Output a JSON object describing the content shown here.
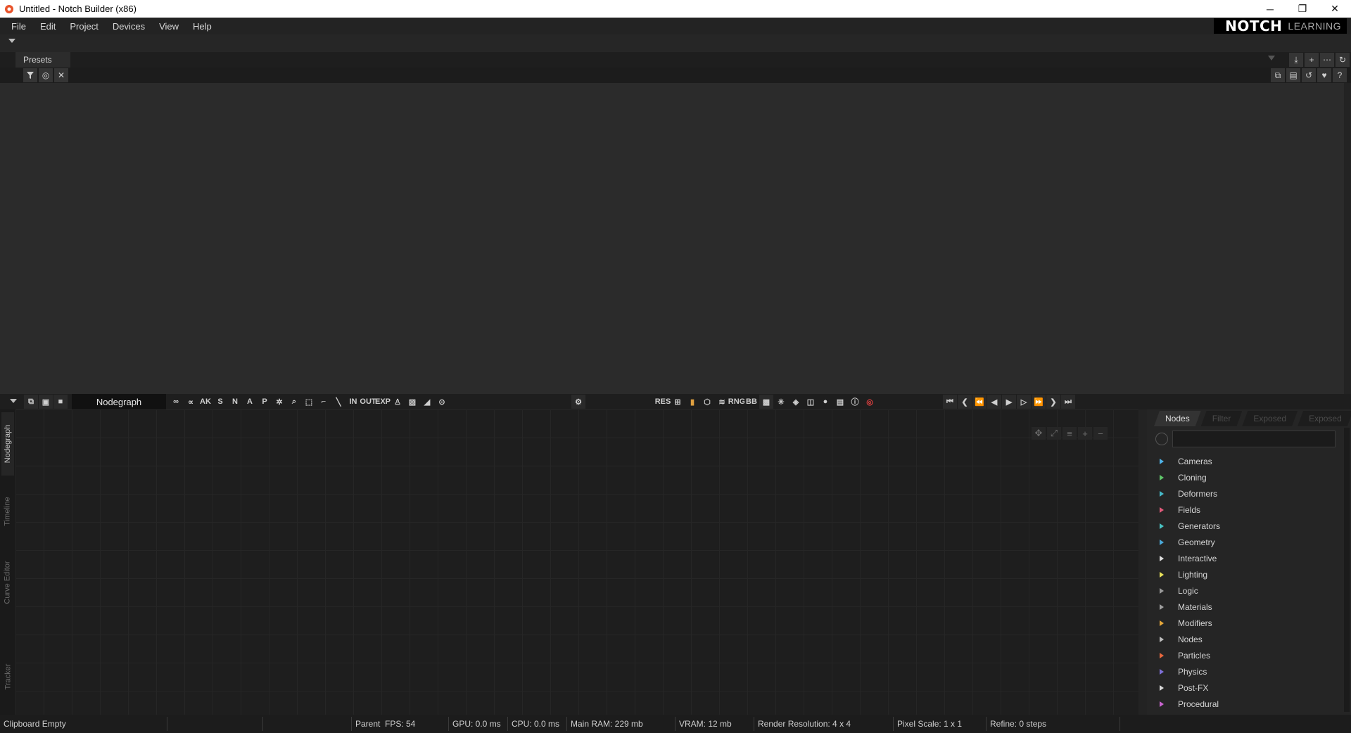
{
  "window": {
    "title": "Untitled - Notch Builder (x86)",
    "controls": {
      "minimize": "─",
      "maximize": "❐",
      "close": "✕"
    }
  },
  "menu": {
    "items": [
      "File",
      "Edit",
      "Project",
      "Devices",
      "View",
      "Help"
    ]
  },
  "brand": {
    "name": "NOTCH",
    "suffix": "LEARNING"
  },
  "presets": {
    "tab_label": "Presets",
    "right_tools": [
      "download-icon",
      "plus-icon",
      "more-icon",
      "refresh-icon"
    ],
    "filter_tools": [
      "filter-icon",
      "target-icon",
      "clear-icon"
    ],
    "side_tools": [
      "copy-icon",
      "paste-icon",
      "undo-icon",
      "favorite-icon",
      "help-icon"
    ]
  },
  "nodegraph": {
    "label": "Nodegraph",
    "toolbar_letters": {
      "ak": "AK",
      "s": "S",
      "n": "N",
      "a": "A",
      "p": "P",
      "in": "IN",
      "out": "OUT",
      "exp": "EXP",
      "rng": "RNG",
      "bb": "BB",
      "res": "RES"
    },
    "side_tabs": [
      "Nodegraph",
      "Timeline",
      "Curve Editor",
      "Tracker"
    ]
  },
  "nodes_panel": {
    "tabs": [
      "Nodes",
      "Filter",
      "Exposed",
      "Exposed"
    ],
    "search_value": "",
    "categories": [
      {
        "label": "Cameras",
        "color": "#4fb3e8"
      },
      {
        "label": "Cloning",
        "color": "#5fc66a"
      },
      {
        "label": "Deformers",
        "color": "#46b9c8"
      },
      {
        "label": "Fields",
        "color": "#e05a7a"
      },
      {
        "label": "Generators",
        "color": "#49c2c2"
      },
      {
        "label": "Geometry",
        "color": "#4aa8d8"
      },
      {
        "label": "Interactive",
        "color": "#dddddd"
      },
      {
        "label": "Lighting",
        "color": "#e7e05a"
      },
      {
        "label": "Logic",
        "color": "#9a9a9a"
      },
      {
        "label": "Materials",
        "color": "#a0a0a0"
      },
      {
        "label": "Modifiers",
        "color": "#e6a73a"
      },
      {
        "label": "Nodes",
        "color": "#bdbdbd"
      },
      {
        "label": "Particles",
        "color": "#e8683e"
      },
      {
        "label": "Physics",
        "color": "#7e70d8"
      },
      {
        "label": "Post-FX",
        "color": "#d8d8d8"
      },
      {
        "label": "Procedural",
        "color": "#c964d0"
      }
    ]
  },
  "status": {
    "clipboard": "Clipboard Empty",
    "parent": "Parent",
    "fps": "FPS: 54",
    "gpu": "GPU: 0.0 ms",
    "cpu": "CPU: 0.0 ms",
    "ram": "Main RAM: 229 mb",
    "vram": "VRAM: 12 mb",
    "render_res": "Render Resolution: 4 x 4",
    "pixel_scale": "Pixel Scale: 1 x 1",
    "refine": "Refine: 0 steps"
  }
}
